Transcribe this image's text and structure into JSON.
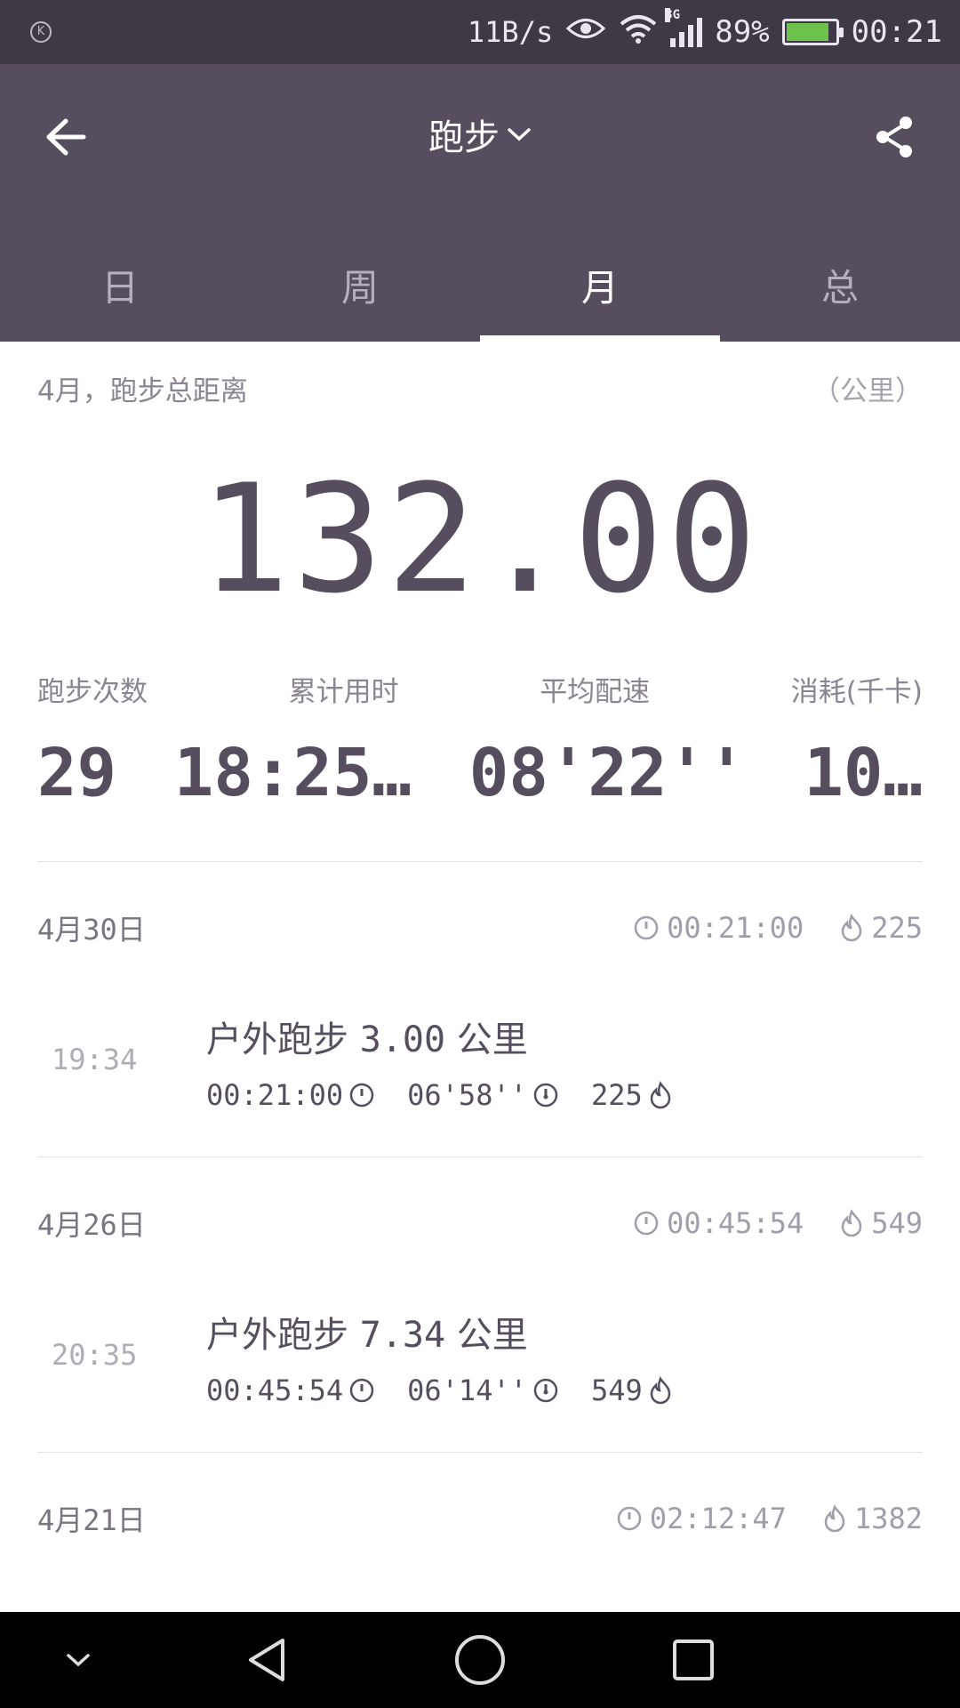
{
  "status_bar": {
    "left_icon": "k-circle-icon",
    "net_speed": "11B/s",
    "network_type": "3G",
    "battery_percent": "89%",
    "battery_level": 0.89,
    "time": "00:21"
  },
  "app_bar": {
    "title": "跑步",
    "icons": {
      "back": "arrow-left-icon",
      "share": "share-icon",
      "dropdown": "chevron-down-icon"
    },
    "tabs": [
      {
        "label": "日",
        "active": false
      },
      {
        "label": "周",
        "active": false
      },
      {
        "label": "月",
        "active": true
      },
      {
        "label": "总",
        "active": false
      }
    ]
  },
  "summary": {
    "label": "4月，跑步总距离",
    "unit": "（公里）",
    "distance": "132.00",
    "stats": [
      {
        "label": "跑步次数",
        "value": "29"
      },
      {
        "label": "累计用时",
        "value": "18:25…"
      },
      {
        "label": "平均配速",
        "value": "08'22''"
      },
      {
        "label": "消耗(千卡)",
        "value": "10…"
      }
    ]
  },
  "days": [
    {
      "date": "4月30日",
      "duration": "00:21:00",
      "calories": "225",
      "run": {
        "time": "19:34",
        "type": "户外跑步",
        "distance": "3.00",
        "unit": "公里",
        "duration": "00:21:00",
        "pace": "06'58''",
        "calories": "225"
      }
    },
    {
      "date": "4月26日",
      "duration": "00:45:54",
      "calories": "549",
      "run": {
        "time": "20:35",
        "type": "户外跑步",
        "distance": "7.34",
        "unit": "公里",
        "duration": "00:45:54",
        "pace": "06'14''",
        "calories": "549"
      }
    },
    {
      "date": "4月21日",
      "duration": "02:12:47",
      "calories": "1382"
    }
  ],
  "nav_bar": {
    "icons": [
      "chevron-down-icon",
      "back-triangle-icon",
      "home-circle-icon",
      "recents-square-icon"
    ]
  },
  "colors": {
    "status_bar": "#3f3946",
    "app_bar": "#564e5e",
    "text_primary": "#564e5e",
    "text_secondary": "#8a8590",
    "battery_green": "#6cc24a"
  }
}
